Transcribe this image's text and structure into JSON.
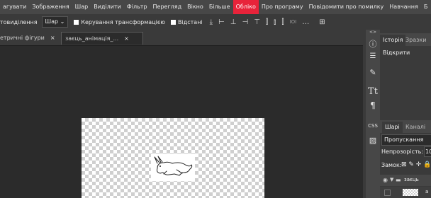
{
  "menubar": {
    "items": [
      {
        "label": "агувати",
        "highlight": false
      },
      {
        "label": "Зображення",
        "highlight": false
      },
      {
        "label": "Шар",
        "highlight": false
      },
      {
        "label": "Виділити",
        "highlight": false
      },
      {
        "label": "Фільтр",
        "highlight": false
      },
      {
        "label": "Перегляд",
        "highlight": false
      },
      {
        "label": "Вікно",
        "highlight": false
      },
      {
        "label": "Більше",
        "highlight": false
      },
      {
        "label": "Обліко",
        "highlight": true
      },
      {
        "label": "Про програму",
        "highlight": false
      },
      {
        "label": "Повідомити про помилку",
        "highlight": false
      },
      {
        "label": "Навчання",
        "highlight": false
      },
      {
        "label": "Б",
        "highlight": false
      }
    ],
    "highlight_color": "#e8233a"
  },
  "options": {
    "selection_label": "товиділення",
    "layer_select": "Шар",
    "transform_label": "Керування трансформацією",
    "distances_label": "Відстані"
  },
  "tabs": [
    {
      "label": "етричні фігури",
      "close": "×"
    },
    {
      "label": "заєць_анімація_...",
      "close": "×"
    }
  ],
  "panel": {
    "collapse_glyph": "<>",
    "top_tabs": [
      "Історія",
      "Зразки"
    ],
    "history_item": "Відкрити",
    "layers_tabs": [
      "Шарі",
      "Каналі"
    ],
    "blend_mode": "Пропускання",
    "opacity_label": "Непрозорість:",
    "opacity_value": "10",
    "lock_label": "Замок:",
    "layer_name": "заєць",
    "layer_name_2": "а"
  },
  "icons": [
    "info-icon",
    "adjust-icon",
    "brush-settings-icon",
    "character-icon",
    "paragraph-icon",
    "css-icon",
    "image-icon",
    "align-icon",
    "grid-icon"
  ]
}
